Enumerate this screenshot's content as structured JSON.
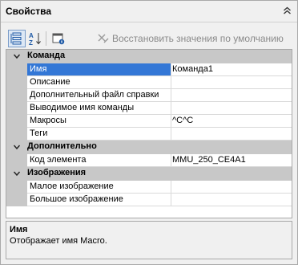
{
  "panel": {
    "title": "Свойства"
  },
  "toolbar": {
    "reset_label": "Восстановить значения по умолчанию",
    "icons": [
      "categorized-view-icon",
      "alphabetical-sort-icon",
      "property-pages-icon",
      "reset-defaults-icon"
    ]
  },
  "grid": {
    "categories": [
      {
        "label": "Команда",
        "rows": [
          {
            "name": "Имя",
            "value": "Команда1"
          },
          {
            "name": "Описание",
            "value": ""
          },
          {
            "name": "Дополнительный файл справки",
            "value": ""
          },
          {
            "name": "Выводимое имя команды",
            "value": ""
          },
          {
            "name": "Макросы",
            "value": "^C^C"
          },
          {
            "name": "Теги",
            "value": ""
          }
        ]
      },
      {
        "label": "Дополнительно",
        "rows": [
          {
            "name": "Код элемента",
            "value": "MMU_250_CE4A1"
          }
        ]
      },
      {
        "label": "Изображения",
        "rows": [
          {
            "name": "Малое изображение",
            "value": ""
          },
          {
            "name": "Большое изображение",
            "value": ""
          }
        ]
      }
    ]
  },
  "description": {
    "title": "Имя",
    "text": "Отображает имя Macro."
  },
  "colors": {
    "selection": "#3377d6",
    "category_bg": "#c8c8c8"
  }
}
